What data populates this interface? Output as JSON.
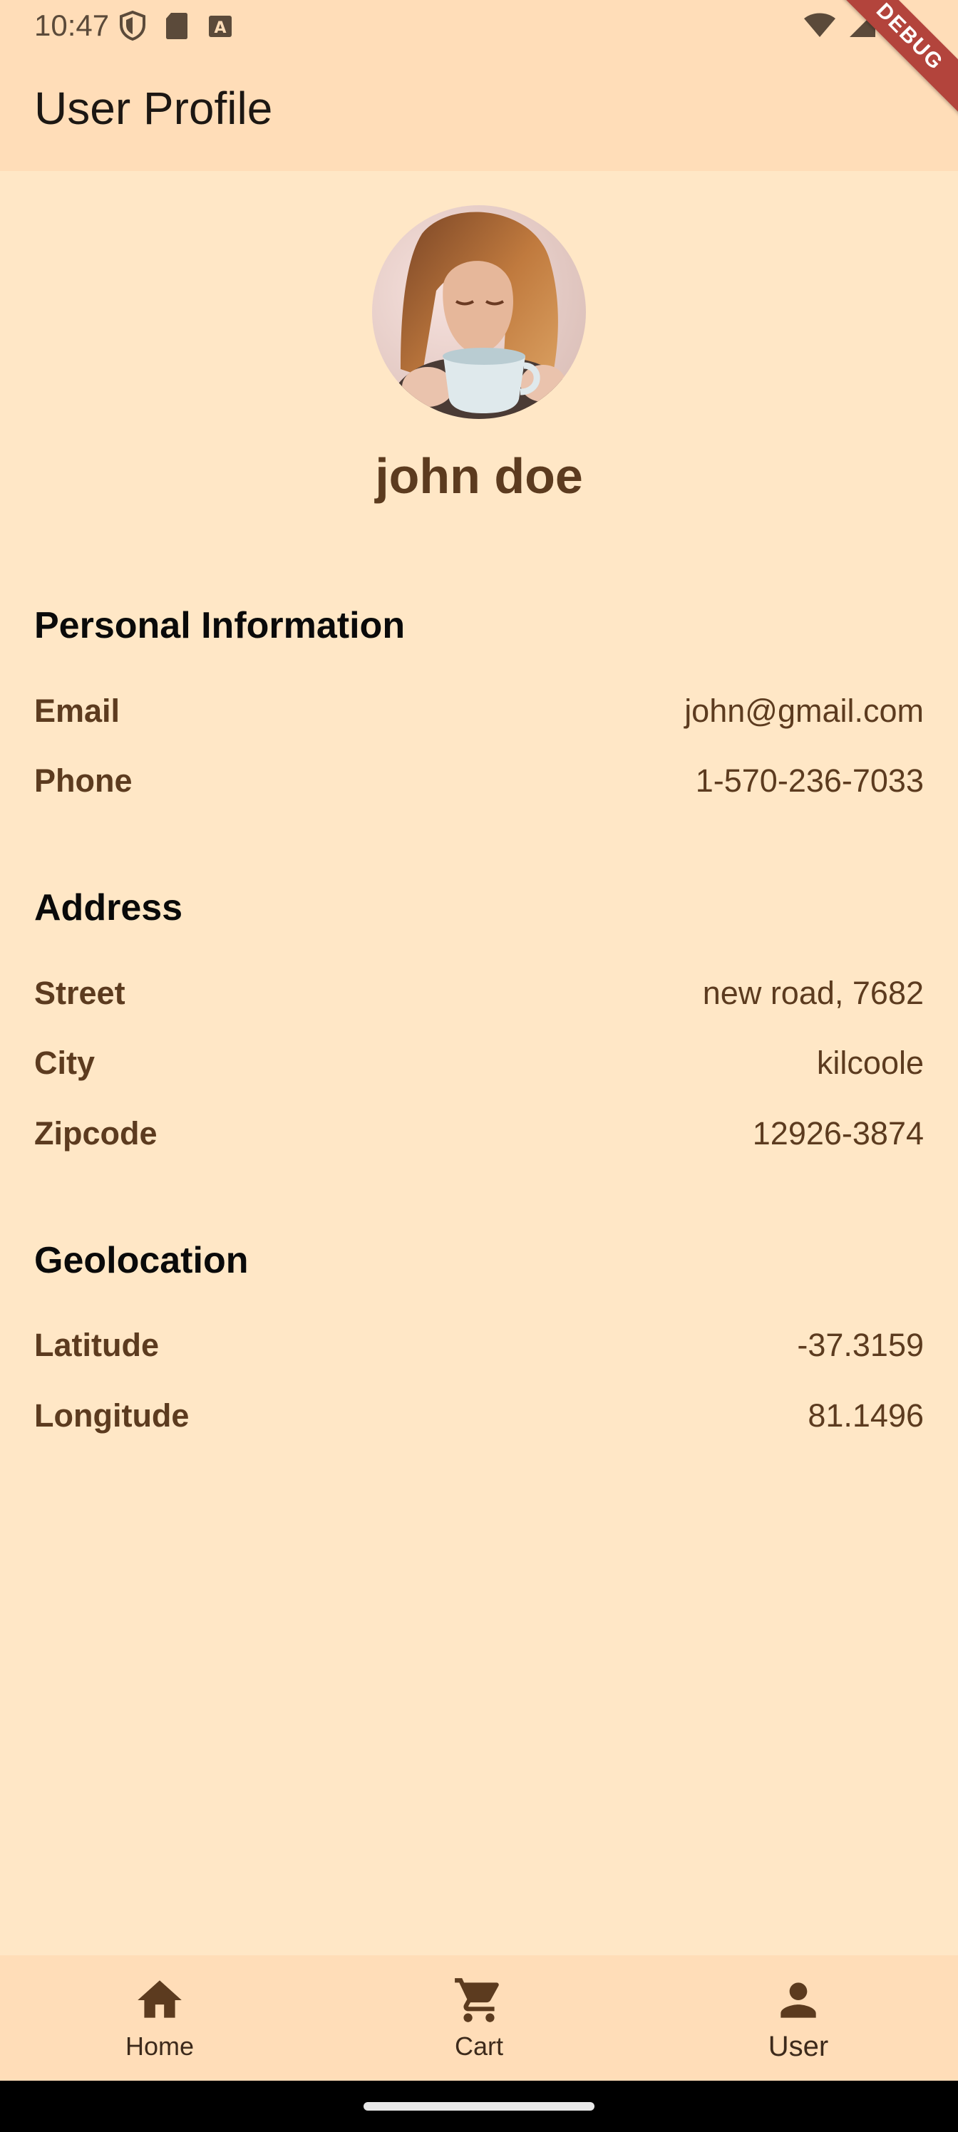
{
  "status_bar": {
    "time": "10:47",
    "left_icons": [
      "shield-icon",
      "sd-card-icon",
      "keyboard-a-icon"
    ],
    "right_icons": [
      "wifi-icon",
      "cell-signal-icon",
      "battery-icon"
    ]
  },
  "debug_banner": "DEBUG",
  "app_bar": {
    "title": "User Profile"
  },
  "profile": {
    "name": "john doe",
    "avatar_icon": "profile-photo"
  },
  "sections": {
    "personal": {
      "title": "Personal Information",
      "rows": [
        {
          "label": "Email",
          "value": "john@gmail.com"
        },
        {
          "label": "Phone",
          "value": "1-570-236-7033"
        }
      ]
    },
    "address": {
      "title": "Address",
      "rows": [
        {
          "label": "Street",
          "value": "new road, 7682"
        },
        {
          "label": "City",
          "value": "kilcoole"
        },
        {
          "label": "Zipcode",
          "value": "12926-3874"
        }
      ]
    },
    "geolocation": {
      "title": "Geolocation",
      "rows": [
        {
          "label": "Latitude",
          "value": "-37.3159"
        },
        {
          "label": "Longitude",
          "value": "81.1496"
        }
      ]
    }
  },
  "bottom_nav": {
    "items": [
      {
        "label": "Home",
        "icon": "home-icon"
      },
      {
        "label": "Cart",
        "icon": "cart-icon"
      },
      {
        "label": "User",
        "icon": "person-icon",
        "active": true
      }
    ]
  },
  "colors": {
    "background": "#FFE7C6",
    "app_bar": "#FFDDB8",
    "accent_text": "#5C3B1F",
    "debug_banner": "#B3443C"
  }
}
